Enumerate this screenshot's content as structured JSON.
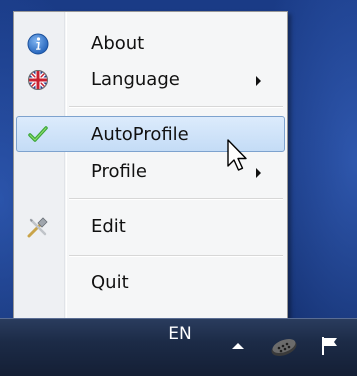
{
  "menu": {
    "items": [
      {
        "label": "About",
        "icon": "info-icon",
        "has_submenu": false
      },
      {
        "label": "Language",
        "icon": "uk-flag-icon",
        "has_submenu": true
      },
      {
        "label": "AutoProfile",
        "icon": "checkmark-icon",
        "has_submenu": false,
        "highlighted": true,
        "checked": true
      },
      {
        "label": "Profile",
        "icon": "",
        "has_submenu": true
      },
      {
        "label": "Edit",
        "icon": "edit-tools-icon",
        "has_submenu": false
      },
      {
        "label": "Quit",
        "icon": "",
        "has_submenu": false
      }
    ]
  },
  "taskbar": {
    "language": "EN",
    "tray_icons": [
      "show-hidden-icons-arrow",
      "app-tray-icon",
      "action-center-flag-icon"
    ]
  },
  "colors": {
    "highlight_bg": "#c4dcf6",
    "highlight_border": "#7da2ce",
    "menu_bg": "#f5f6f7",
    "taskbar": "#1c2b47",
    "desktop": "#17367e"
  }
}
